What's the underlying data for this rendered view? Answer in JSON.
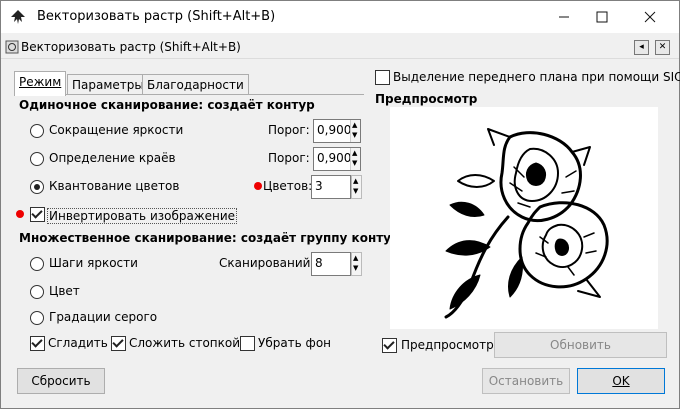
{
  "window": {
    "title": "Векторизовать растр (Shift+Alt+B)"
  },
  "dock": {
    "title": "Векторизовать растр (Shift+Alt+B)"
  },
  "tabs": [
    {
      "label": "Режим"
    },
    {
      "label": "Параметры"
    },
    {
      "label": "Благодарности"
    }
  ],
  "single_scan": {
    "heading": "Одиночное сканирование: создаёт контур",
    "options": [
      {
        "label": "Сокращение яркости",
        "param_label": "Порог:",
        "param_value": "0,900"
      },
      {
        "label": "Определение краёв",
        "param_label": "Порог:",
        "param_value": "0,900"
      },
      {
        "label": "Квантование цветов",
        "param_label": "Цветов:",
        "param_value": "3",
        "selected": true
      }
    ],
    "invert_label": "Инвертировать изображение"
  },
  "multi_scan": {
    "heading": "Множественное сканирование: создаёт группу контуров",
    "options": [
      {
        "label": "Шаги яркости",
        "param_label": "Сканирований:",
        "param_value": "8"
      },
      {
        "label": "Цвет"
      },
      {
        "label": "Градации серого"
      }
    ],
    "smooth_label": "Сгладить",
    "stack_label": "Сложить стопкой",
    "remove_bg_label": "Убрать фон"
  },
  "right_panel": {
    "siox_label": "Выделение переднего плана при помощи SIOX",
    "preview_heading": "Предпросмотр",
    "preview_check_label": "Предпросмотр",
    "update_label": "Обновить"
  },
  "footer": {
    "reset_label": "Сбросить",
    "stop_label": "Остановить",
    "ok_label": "OK"
  }
}
